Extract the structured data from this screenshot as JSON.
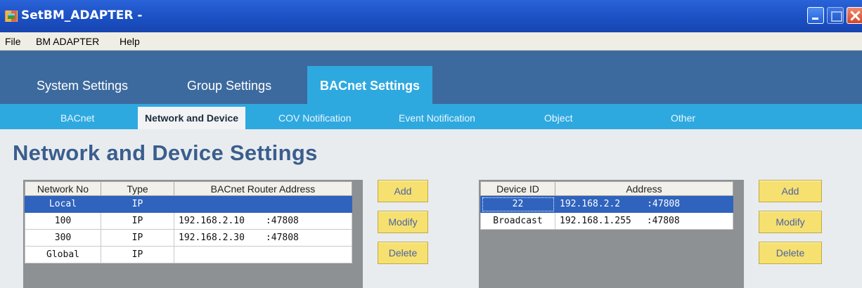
{
  "window": {
    "title": "SetBM_ADAPTER -"
  },
  "menu": {
    "items": [
      "File",
      "BM ADAPTER",
      "Help"
    ]
  },
  "main_tabs": [
    "System Settings",
    "Group Settings",
    "BACnet Settings"
  ],
  "sub_tabs": [
    "BACnet",
    "Network and Device",
    "COV Notification",
    "Event Notification",
    "Object",
    "Other"
  ],
  "active_main_tab": "BACnet Settings",
  "active_sub_tab": "Network and Device",
  "page_heading": "Network and Device Settings",
  "network_table": {
    "headers": [
      "Network No",
      "Type",
      "BACnet Router Address"
    ],
    "rows": [
      {
        "network_no": "Local",
        "type": "IP",
        "ip": "",
        "port": "",
        "selected": true
      },
      {
        "network_no": "100",
        "type": "IP",
        "ip": "192.168.2.10",
        "port": ":47808",
        "selected": false
      },
      {
        "network_no": "300",
        "type": "IP",
        "ip": "192.168.2.30",
        "port": ":47808",
        "selected": false
      },
      {
        "network_no": "Global",
        "type": "IP",
        "ip": "",
        "port": "",
        "selected": false
      }
    ]
  },
  "device_table": {
    "headers": [
      "Device ID",
      "Address"
    ],
    "rows": [
      {
        "device_id": "22",
        "ip": "192.168.2.2",
        "port": ":47808",
        "selected": true
      },
      {
        "device_id": "Broadcast",
        "ip": "192.168.1.255",
        "port": ":47808",
        "selected": false
      }
    ]
  },
  "buttons": {
    "add": "Add",
    "modify": "Modify",
    "delete": "Delete"
  },
  "colors": {
    "title_bar": "#1a4fc2",
    "main_band": "#3d6a9e",
    "sub_band": "#2ea9e0",
    "selection": "#2f63bd",
    "button_yellow": "#f6e06f",
    "heading": "#3a5e8d"
  }
}
